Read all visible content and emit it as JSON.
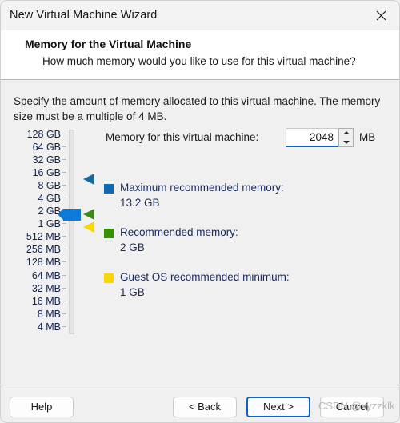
{
  "window": {
    "title": "New Virtual Machine Wizard",
    "close_icon": "close-icon"
  },
  "header": {
    "title": "Memory for the Virtual Machine",
    "subtitle": "How much memory would you like to use for this virtual machine?"
  },
  "body": {
    "intro": "Specify the amount of memory allocated to this virtual machine. The memory size must be a multiple of 4 MB.",
    "memory_label": "Memory for this virtual machine:",
    "memory_value": "2048",
    "memory_unit": "MB",
    "scale": [
      "128 GB",
      "64 GB",
      "32 GB",
      "16 GB",
      "8 GB",
      "4 GB",
      "2 GB",
      "1 GB",
      "512 MB",
      "256 MB",
      "128 MB",
      "64 MB",
      "32 MB",
      "16 MB",
      "8 MB",
      "4 MB"
    ],
    "slider": {
      "thumb_value": "2 GB",
      "thumb_color": "#0c7ad6",
      "markers": [
        {
          "name": "maximum-recommended",
          "value": "16 GB",
          "color": "#17699f"
        },
        {
          "name": "recommended",
          "value": "2 GB",
          "color": "#3b8a15"
        },
        {
          "name": "guest-os-minimum",
          "value": "1 GB",
          "color": "#fbd600"
        }
      ]
    },
    "legend": [
      {
        "label": "Maximum recommended memory:",
        "value": "13.2 GB",
        "color": "#1069b0"
      },
      {
        "label": "Recommended memory:",
        "value": "2 GB",
        "color": "#349100"
      },
      {
        "label": "Guest OS recommended minimum:",
        "value": "1 GB",
        "color": "#fbd600"
      }
    ]
  },
  "footer": {
    "help": "Help",
    "back": "< Back",
    "next": "Next >",
    "cancel": "Cancel"
  },
  "watermark": "CSDN @xyzzklk"
}
